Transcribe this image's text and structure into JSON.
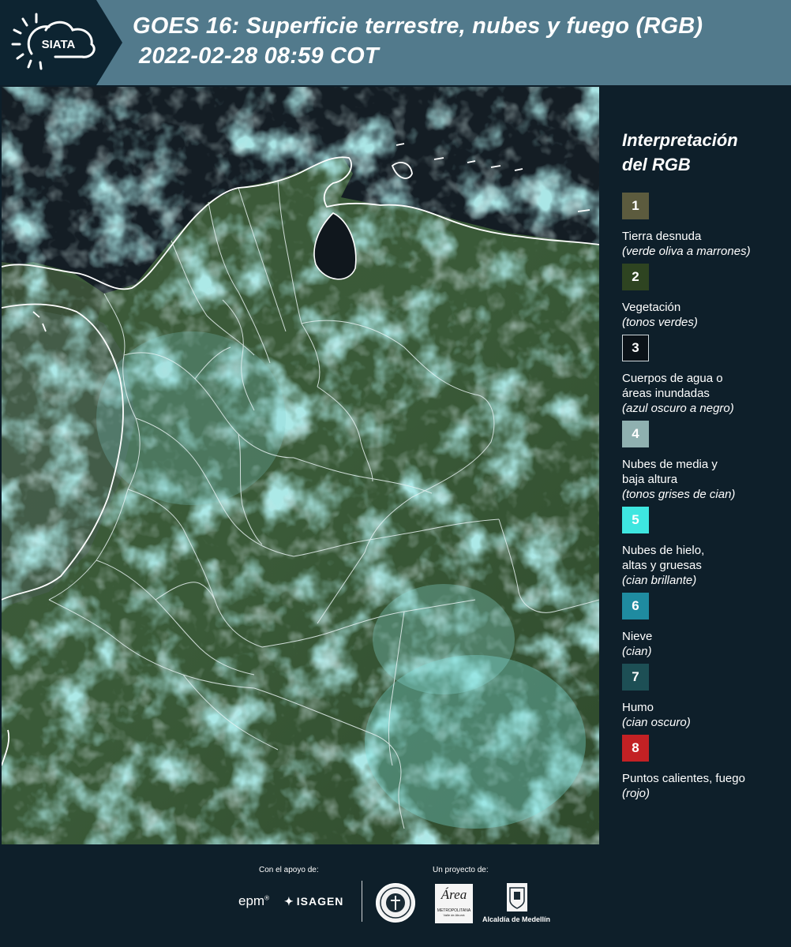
{
  "header": {
    "logo_text": "SIATA",
    "title_line1": "GOES 16: Superficie terrestre, nubes y fuego (RGB)",
    "title_line2": "2022-02-28 08:59 COT"
  },
  "legend": {
    "title_line1": "Interpretación",
    "title_line2": "del RGB",
    "items": [
      {
        "num": "1",
        "color": "#5c5b3e",
        "lines": [
          "Tierra desnuda"
        ],
        "sub": "(verde oliva a marrones)"
      },
      {
        "num": "2",
        "color": "#2e4421",
        "lines": [
          "Vegetación"
        ],
        "sub": "(tonos verdes)"
      },
      {
        "num": "3",
        "color": "#0b1218",
        "lines": [
          "Cuerpos de agua o",
          "áreas inundadas"
        ],
        "sub": "(azul oscuro a negro)"
      },
      {
        "num": "4",
        "color": "#8fb0b0",
        "lines": [
          "Nubes de media y",
          "baja altura"
        ],
        "sub": "(tonos grises de cian)"
      },
      {
        "num": "5",
        "color": "#3ee6e0",
        "lines": [
          "Nubes de hielo,",
          "altas y gruesas"
        ],
        "sub": "(cian brillante)"
      },
      {
        "num": "6",
        "color": "#1f8ba0",
        "lines": [
          "Nieve"
        ],
        "sub": "(cian)"
      },
      {
        "num": "7",
        "color": "#1d4f55",
        "lines": [
          "Humo"
        ],
        "sub": "(cian oscuro)"
      },
      {
        "num": "8",
        "color": "#c32124",
        "lines": [
          "Puntos calientes, fuego"
        ],
        "sub": "(rojo)"
      }
    ]
  },
  "footer": {
    "support_label": "Con el apoyo de:",
    "project_label": "Un proyecto de:",
    "epm": "epm",
    "isagen": "ISAGEN",
    "area_metro": "Área",
    "area_metro_sub": "METROPOLITANA",
    "area_metro_sub2": "Valle de Aburrá",
    "alcaldia": "Alcaldía de Medellín"
  }
}
